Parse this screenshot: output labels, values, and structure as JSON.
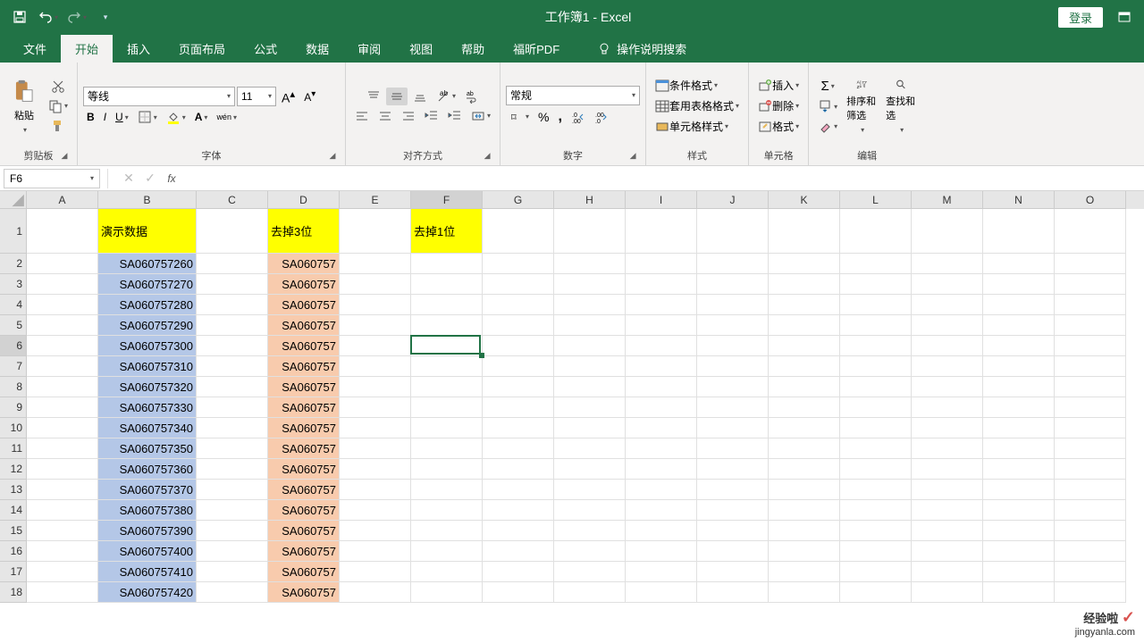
{
  "title": {
    "workbook": "工作簿1",
    "sep": " - ",
    "app": "Excel"
  },
  "qat": {
    "login": "登录"
  },
  "tabs": {
    "file": "文件",
    "home": "开始",
    "insert": "插入",
    "layout": "页面布局",
    "formula": "公式",
    "data": "数据",
    "review": "审阅",
    "view": "视图",
    "help": "帮助",
    "foxit": "福昕PDF",
    "tell": "操作说明搜索"
  },
  "ribbon": {
    "clipboard": {
      "paste": "粘贴",
      "label": "剪贴板"
    },
    "font": {
      "name": "等线",
      "size": "11",
      "label": "字体",
      "pinyin": "wén"
    },
    "align": {
      "label": "对齐方式"
    },
    "number": {
      "format": "常规",
      "label": "数字"
    },
    "styles": {
      "cond": "条件格式",
      "table": "套用表格格式",
      "cell": "单元格样式",
      "label": "样式"
    },
    "cells": {
      "insert": "插入",
      "delete": "删除",
      "format": "格式",
      "label": "单元格"
    },
    "editing": {
      "sort": "排序和筛选",
      "find": "查找和选",
      "label": "编辑"
    }
  },
  "formula_bar": {
    "name_box": "F6",
    "formula": ""
  },
  "columns": [
    {
      "letter": "A",
      "width": 80
    },
    {
      "letter": "B",
      "width": 110
    },
    {
      "letter": "C",
      "width": 80
    },
    {
      "letter": "D",
      "width": 80
    },
    {
      "letter": "E",
      "width": 80
    },
    {
      "letter": "F",
      "width": 80
    },
    {
      "letter": "G",
      "width": 80
    },
    {
      "letter": "H",
      "width": 80
    },
    {
      "letter": "I",
      "width": 80
    },
    {
      "letter": "J",
      "width": 80
    },
    {
      "letter": "K",
      "width": 80
    },
    {
      "letter": "L",
      "width": 80
    },
    {
      "letter": "M",
      "width": 80
    },
    {
      "letter": "N",
      "width": 80
    },
    {
      "letter": "O",
      "width": 80
    }
  ],
  "header_row": {
    "B": "演示数据",
    "D": "去掉3位",
    "F": "去掉1位"
  },
  "data_rows": [
    {
      "row": 2,
      "B": "SA060757260",
      "D": "SA060757"
    },
    {
      "row": 3,
      "B": "SA060757270",
      "D": "SA060757"
    },
    {
      "row": 4,
      "B": "SA060757280",
      "D": "SA060757"
    },
    {
      "row": 5,
      "B": "SA060757290",
      "D": "SA060757"
    },
    {
      "row": 6,
      "B": "SA060757300",
      "D": "SA060757"
    },
    {
      "row": 7,
      "B": "SA060757310",
      "D": "SA060757"
    },
    {
      "row": 8,
      "B": "SA060757320",
      "D": "SA060757"
    },
    {
      "row": 9,
      "B": "SA060757330",
      "D": "SA060757"
    },
    {
      "row": 10,
      "B": "SA060757340",
      "D": "SA060757"
    },
    {
      "row": 11,
      "B": "SA060757350",
      "D": "SA060757"
    },
    {
      "row": 12,
      "B": "SA060757360",
      "D": "SA060757"
    },
    {
      "row": 13,
      "B": "SA060757370",
      "D": "SA060757"
    },
    {
      "row": 14,
      "B": "SA060757380",
      "D": "SA060757"
    },
    {
      "row": 15,
      "B": "SA060757390",
      "D": "SA060757"
    },
    {
      "row": 16,
      "B": "SA060757400",
      "D": "SA060757"
    },
    {
      "row": 17,
      "B": "SA060757410",
      "D": "SA060757"
    },
    {
      "row": 18,
      "B": "SA060757420",
      "D": "SA060757"
    }
  ],
  "active_cell": {
    "col": "F",
    "row": 6
  },
  "watermark": {
    "line1": "经验啦",
    "check": "✓",
    "line2": "jingyanla.com"
  }
}
